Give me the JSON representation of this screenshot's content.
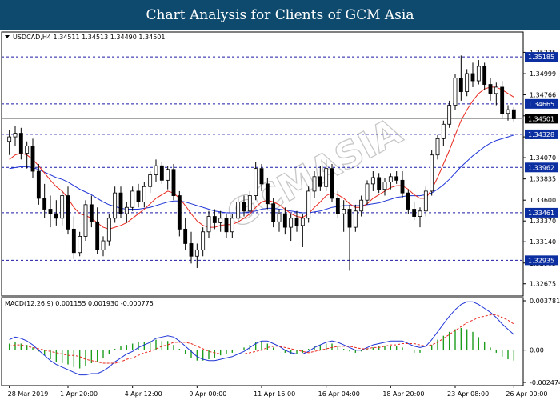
{
  "banner": {
    "title": "Chart Analysis for Clients of GCM Asia"
  },
  "watermark": "GCMASIA",
  "chart_data": [
    {
      "type": "candlestick",
      "symbol_label": "USDCAD,H4  1.34511 1.34513 1.34490 1.34501",
      "ylim": [
        1.3254,
        1.3546
      ],
      "y_ticks": [
        "1.35235",
        "1.34999",
        "1.34766",
        "1.34533",
        "1.34300",
        "1.34070",
        "1.33835",
        "1.33600",
        "1.33370",
        "1.33140",
        "1.32905",
        "1.32675"
      ],
      "price_labels": [
        {
          "label": "1.35185",
          "value": 1.35185,
          "kind": "resistance"
        },
        {
          "label": "1.34665",
          "value": 1.34665,
          "kind": "resistance"
        },
        {
          "label": "1.34501",
          "value": 1.34501,
          "kind": "current"
        },
        {
          "label": "1.34328",
          "value": 1.34328,
          "kind": "support"
        },
        {
          "label": "1.33962",
          "value": 1.33962,
          "kind": "support"
        },
        {
          "label": "1.33461",
          "value": 1.33461,
          "kind": "support"
        },
        {
          "label": "1.32935",
          "value": 1.32935,
          "kind": "support"
        }
      ],
      "x_ticks": [
        "28 Mar 2019",
        "1 Apr 20:00",
        "4 Apr 12:00",
        "9 Apr 00:00",
        "11 Apr 16:00",
        "16 Apr 04:00",
        "18 Apr 20:00",
        "23 Apr 08:00",
        "26 Apr 00:00"
      ],
      "candles": [
        [
          1.3425,
          1.3438,
          1.341,
          1.343
        ],
        [
          1.343,
          1.3442,
          1.342,
          1.3434
        ],
        [
          1.3434,
          1.344,
          1.3405,
          1.3412
        ],
        [
          1.3412,
          1.3425,
          1.3395,
          1.342
        ],
        [
          1.342,
          1.3428,
          1.3385,
          1.3392
        ],
        [
          1.3392,
          1.34,
          1.3355,
          1.3362
        ],
        [
          1.3362,
          1.3378,
          1.334,
          1.335
        ],
        [
          1.335,
          1.3365,
          1.333,
          1.3345
        ],
        [
          1.3345,
          1.336,
          1.3332,
          1.334
        ],
        [
          1.334,
          1.337,
          1.3332,
          1.3365
        ],
        [
          1.3365,
          1.3375,
          1.3322,
          1.3328
        ],
        [
          1.3328,
          1.3342,
          1.3295,
          1.3302
        ],
        [
          1.3302,
          1.3325,
          1.3298,
          1.332
        ],
        [
          1.332,
          1.336,
          1.3315,
          1.3355
        ],
        [
          1.3355,
          1.3365,
          1.333,
          1.3336
        ],
        [
          1.3336,
          1.3352,
          1.33,
          1.3305
        ],
        [
          1.3305,
          1.332,
          1.3298,
          1.3315
        ],
        [
          1.3315,
          1.3345,
          1.331,
          1.334
        ],
        [
          1.334,
          1.3375,
          1.3335,
          1.3368
        ],
        [
          1.3368,
          1.3375,
          1.334,
          1.3345
        ],
        [
          1.3345,
          1.3358,
          1.3335,
          1.3352
        ],
        [
          1.3352,
          1.3375,
          1.3348,
          1.337
        ],
        [
          1.337,
          1.3378,
          1.3352,
          1.3358
        ],
        [
          1.3358,
          1.338,
          1.3352,
          1.3375
        ],
        [
          1.3375,
          1.3392,
          1.3368,
          1.3388
        ],
        [
          1.3388,
          1.3405,
          1.338,
          1.3398
        ],
        [
          1.3398,
          1.3402,
          1.3378,
          1.3382
        ],
        [
          1.3382,
          1.3398,
          1.3372,
          1.3394
        ],
        [
          1.3394,
          1.34,
          1.336,
          1.3365
        ],
        [
          1.3365,
          1.337,
          1.332,
          1.3328
        ],
        [
          1.3328,
          1.334,
          1.3305,
          1.3312
        ],
        [
          1.3312,
          1.3325,
          1.329,
          1.3298
        ],
        [
          1.3298,
          1.3312,
          1.3285,
          1.3305
        ],
        [
          1.3305,
          1.333,
          1.3298,
          1.3325
        ],
        [
          1.3325,
          1.3348,
          1.3318,
          1.3342
        ],
        [
          1.3342,
          1.335,
          1.3328,
          1.3335
        ],
        [
          1.3335,
          1.3348,
          1.3325,
          1.334
        ],
        [
          1.334,
          1.3345,
          1.3318,
          1.3325
        ],
        [
          1.3325,
          1.3345,
          1.3318,
          1.334
        ],
        [
          1.334,
          1.3362,
          1.3335,
          1.3358
        ],
        [
          1.3358,
          1.3365,
          1.3342,
          1.3348
        ],
        [
          1.3348,
          1.337,
          1.3342,
          1.3365
        ],
        [
          1.3365,
          1.3402,
          1.336,
          1.3395
        ],
        [
          1.3395,
          1.34,
          1.337,
          1.3378
        ],
        [
          1.3378,
          1.3385,
          1.335,
          1.3356
        ],
        [
          1.3356,
          1.3362,
          1.333,
          1.3336
        ],
        [
          1.3336,
          1.335,
          1.3325,
          1.3345
        ],
        [
          1.3345,
          1.3352,
          1.3322,
          1.333
        ],
        [
          1.333,
          1.3345,
          1.3315,
          1.334
        ],
        [
          1.334,
          1.3348,
          1.3325,
          1.3332
        ],
        [
          1.3332,
          1.3345,
          1.3308,
          1.334
        ],
        [
          1.334,
          1.3375,
          1.3335,
          1.337
        ],
        [
          1.337,
          1.3392,
          1.3362,
          1.3386
        ],
        [
          1.3386,
          1.3398,
          1.337,
          1.3375
        ],
        [
          1.3375,
          1.3405,
          1.337,
          1.3395
        ],
        [
          1.3395,
          1.34,
          1.3358,
          1.3362
        ],
        [
          1.3362,
          1.337,
          1.334,
          1.3345
        ],
        [
          1.3345,
          1.336,
          1.3325,
          1.335
        ],
        [
          1.335,
          1.3355,
          1.3282,
          1.333
        ],
        [
          1.333,
          1.3355,
          1.3325,
          1.3348
        ],
        [
          1.3348,
          1.3365,
          1.3342,
          1.336
        ],
        [
          1.336,
          1.3382,
          1.3355,
          1.3378
        ],
        [
          1.3378,
          1.3392,
          1.337,
          1.3385
        ],
        [
          1.3385,
          1.339,
          1.3368,
          1.3372
        ],
        [
          1.3372,
          1.3385,
          1.3365,
          1.338
        ],
        [
          1.338,
          1.339,
          1.3372,
          1.3386
        ],
        [
          1.3386,
          1.3392,
          1.3378,
          1.3382
        ],
        [
          1.3382,
          1.3392,
          1.3362,
          1.3368
        ],
        [
          1.3368,
          1.3372,
          1.3345,
          1.335
        ],
        [
          1.335,
          1.3358,
          1.3338,
          1.3342
        ],
        [
          1.3342,
          1.3352,
          1.333,
          1.3348
        ],
        [
          1.3348,
          1.3375,
          1.3342,
          1.337
        ],
        [
          1.337,
          1.3415,
          1.3365,
          1.341
        ],
        [
          1.341,
          1.3432,
          1.3405,
          1.3428
        ],
        [
          1.3428,
          1.3448,
          1.342,
          1.3444
        ],
        [
          1.3444,
          1.347,
          1.344,
          1.3465
        ],
        [
          1.3465,
          1.35,
          1.346,
          1.3495
        ],
        [
          1.3495,
          1.352,
          1.347,
          1.348
        ],
        [
          1.348,
          1.3505,
          1.3475,
          1.35
        ],
        [
          1.35,
          1.3512,
          1.3485,
          1.3492
        ],
        [
          1.3492,
          1.3515,
          1.3488,
          1.3508
        ],
        [
          1.3508,
          1.3512,
          1.3482,
          1.3488
        ],
        [
          1.3488,
          1.3495,
          1.347,
          1.3478
        ],
        [
          1.3478,
          1.349,
          1.3465,
          1.3485
        ],
        [
          1.3485,
          1.3492,
          1.345,
          1.3456
        ],
        [
          1.3456,
          1.3465,
          1.3448,
          1.346
        ],
        [
          1.346,
          1.3463,
          1.3447,
          1.345
        ]
      ],
      "indicators": {
        "ma_fast": [
          1.3405,
          1.341,
          1.3412,
          1.341,
          1.3405,
          1.3398,
          1.339,
          1.3382,
          1.3375,
          1.337,
          1.3362,
          1.3352,
          1.3345,
          1.3343,
          1.334,
          1.3335,
          1.333,
          1.3328,
          1.333,
          1.3332,
          1.3335,
          1.334,
          1.3345,
          1.335,
          1.3356,
          1.3362,
          1.3366,
          1.337,
          1.3368,
          1.3362,
          1.3354,
          1.3345,
          1.3337,
          1.3332,
          1.333,
          1.333,
          1.3332,
          1.3333,
          1.3333,
          1.3336,
          1.334,
          1.3345,
          1.3352,
          1.3358,
          1.336,
          1.3358,
          1.3355,
          1.335,
          1.3345,
          1.3342,
          1.3341,
          1.3345,
          1.3352,
          1.3358,
          1.3365,
          1.3368,
          1.3366,
          1.3362,
          1.3356,
          1.3352,
          1.3352,
          1.3356,
          1.3362,
          1.3366,
          1.337,
          1.3374,
          1.3376,
          1.3376,
          1.3372,
          1.3366,
          1.3362,
          1.3362,
          1.3372,
          1.3385,
          1.34,
          1.3415,
          1.3432,
          1.3448,
          1.346,
          1.347,
          1.3478,
          1.3483,
          1.3485,
          1.3485,
          1.3482,
          1.3478,
          1.3474
        ],
        "ma_slow": [
          1.3395,
          1.3396,
          1.3397,
          1.3397,
          1.3396,
          1.3394,
          1.3391,
          1.3388,
          1.3385,
          1.3383,
          1.338,
          1.3376,
          1.3372,
          1.3369,
          1.3366,
          1.3362,
          1.3358,
          1.3355,
          1.3353,
          1.3351,
          1.335,
          1.335,
          1.335,
          1.3351,
          1.3352,
          1.3354,
          1.3356,
          1.3358,
          1.3359,
          1.3359,
          1.3358,
          1.3356,
          1.3354,
          1.3352,
          1.335,
          1.3348,
          1.3347,
          1.3346,
          1.3346,
          1.3346,
          1.3346,
          1.3347,
          1.3348,
          1.335,
          1.3351,
          1.3351,
          1.335,
          1.3349,
          1.3348,
          1.3347,
          1.3346,
          1.3346,
          1.3347,
          1.3348,
          1.335,
          1.3352,
          1.3353,
          1.3354,
          1.3354,
          1.3354,
          1.3354,
          1.3355,
          1.3356,
          1.3357,
          1.3359,
          1.3361,
          1.3363,
          1.3364,
          1.3365,
          1.3365,
          1.3365,
          1.3366,
          1.3368,
          1.3372,
          1.3377,
          1.3383,
          1.339,
          1.3397,
          1.3403,
          1.3409,
          1.3414,
          1.3419,
          1.3423,
          1.3426,
          1.3428,
          1.343,
          1.3432
        ]
      }
    },
    {
      "type": "macd",
      "label": "MACD(12,26,9) 0.001155 0.001930 -0.000775",
      "ylim": [
        -0.002474,
        0.003781
      ],
      "y_ticks": [
        "0.003781",
        "0.00",
        "-0.002474"
      ],
      "histogram": [
        0.0005,
        0.0006,
        0.0005,
        0.0004,
        0.0002,
        -0.0001,
        -0.0004,
        -0.0007,
        -0.0009,
        -0.001,
        -0.0011,
        -0.0013,
        -0.0014,
        -0.0012,
        -0.001,
        -0.0009,
        -0.0006,
        -0.0003,
        0.0001,
        0.0003,
        0.0004,
        0.0005,
        0.0006,
        0.0006,
        0.0007,
        0.0008,
        0.0007,
        0.0007,
        0.0004,
        0.0001,
        -0.0003,
        -0.0006,
        -0.0008,
        -0.0008,
        -0.0007,
        -0.0006,
        -0.0004,
        -0.0003,
        -0.0002,
        0.0,
        0.0002,
        0.0004,
        0.0006,
        0.0007,
        0.0005,
        0.0002,
        0.0,
        -0.0002,
        -0.0003,
        -0.0003,
        -0.0002,
        0.0001,
        0.0003,
        0.0004,
        0.0005,
        0.0005,
        0.0003,
        0.0001,
        -0.0001,
        -0.0002,
        -0.0001,
        0.0001,
        0.0002,
        0.0003,
        0.0003,
        0.0003,
        0.0003,
        0.0002,
        0.0,
        -0.0002,
        -0.0002,
        0.0,
        0.0004,
        0.0008,
        0.0011,
        0.0014,
        0.0016,
        0.0017,
        0.0016,
        0.0014,
        0.001,
        0.0006,
        0.0002,
        -0.0002,
        -0.0005,
        -0.0007,
        -0.0008
      ],
      "macd": [
        0.0008,
        0.001,
        0.0009,
        0.0007,
        0.0004,
        0.0,
        -0.0004,
        -0.0008,
        -0.0011,
        -0.0013,
        -0.0015,
        -0.0017,
        -0.0019,
        -0.0019,
        -0.0018,
        -0.0018,
        -0.0016,
        -0.0013,
        -0.0009,
        -0.0006,
        -0.0003,
        -0.0001,
        0.0002,
        0.0004,
        0.0006,
        0.0009,
        0.001,
        0.0011,
        0.001,
        0.0007,
        0.0003,
        -0.0001,
        -0.0005,
        -0.0007,
        -0.0008,
        -0.0008,
        -0.0007,
        -0.0006,
        -0.0005,
        -0.0003,
        -0.0001,
        0.0002,
        0.0005,
        0.0007,
        0.0007,
        0.0005,
        0.0003,
        0.0,
        -0.0002,
        -0.0003,
        -0.0003,
        -0.0001,
        0.0002,
        0.0004,
        0.0006,
        0.0007,
        0.0006,
        0.0004,
        0.0002,
        0.0,
        0.0,
        0.0002,
        0.0004,
        0.0005,
        0.0006,
        0.0007,
        0.0007,
        0.0007,
        0.0005,
        0.0003,
        0.0002,
        0.0003,
        0.0008,
        0.0014,
        0.002,
        0.0026,
        0.0031,
        0.0035,
        0.0037,
        0.0037,
        0.0035,
        0.0032,
        0.0029,
        0.0025,
        0.002,
        0.0016,
        0.0012
      ],
      "signal": [
        0.0003,
        0.0004,
        0.0004,
        0.0003,
        0.0002,
        0.0001,
        0.0,
        -0.0001,
        -0.0002,
        -0.0003,
        -0.0004,
        -0.0004,
        -0.0005,
        -0.0007,
        -0.0008,
        -0.0009,
        -0.001,
        -0.001,
        -0.001,
        -0.0009,
        -0.0007,
        -0.0006,
        -0.0004,
        -0.0002,
        -0.0001,
        0.0001,
        0.0003,
        0.0004,
        0.0006,
        0.0006,
        0.0006,
        0.0005,
        0.0003,
        0.0001,
        -0.0001,
        -0.0002,
        -0.0003,
        -0.0003,
        -0.0003,
        -0.0003,
        -0.0003,
        -0.0002,
        -0.0001,
        0.0,
        0.0002,
        0.0003,
        0.0003,
        0.0002,
        0.0001,
        0.0,
        -0.0001,
        -0.0002,
        -0.0001,
        0.0,
        0.0001,
        0.0002,
        0.0003,
        0.0003,
        0.0003,
        0.0002,
        0.0001,
        0.0001,
        0.0002,
        0.0002,
        0.0003,
        0.0004,
        0.0004,
        0.0005,
        0.0005,
        0.0005,
        0.0004,
        0.0003,
        0.0004,
        0.0006,
        0.0009,
        0.0012,
        0.0015,
        0.0018,
        0.0021,
        0.0023,
        0.0025,
        0.0026,
        0.0027,
        0.0027,
        0.0025,
        0.0023,
        0.002
      ]
    }
  ],
  "colors": {
    "banner_bg": "#0e4a6e",
    "ma_fast": "#e8281e",
    "ma_slow": "#1f35d6",
    "hist": "#1c9e1c",
    "level_line": "#1a1aa8",
    "label_bg": "#0b2ea0",
    "current_bg": "#000000"
  }
}
